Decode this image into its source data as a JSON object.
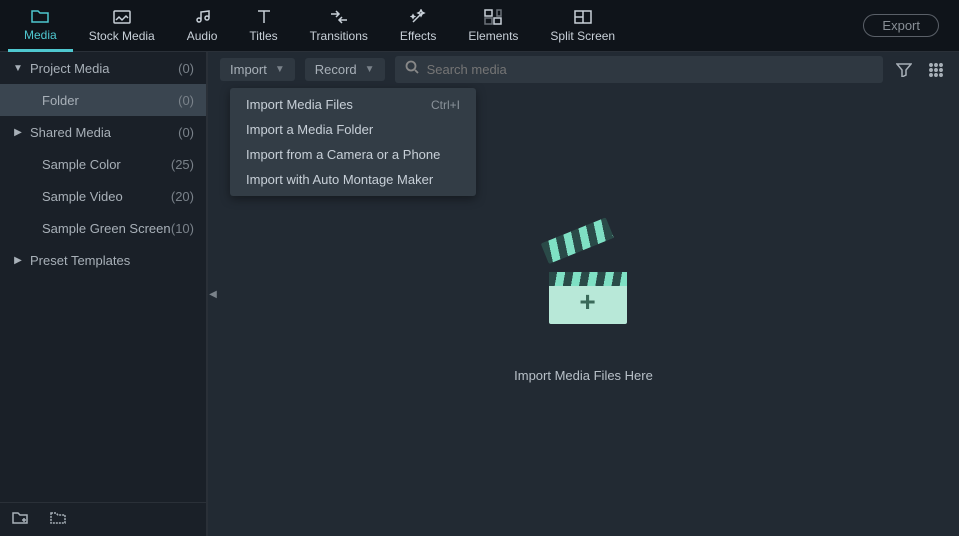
{
  "toolbar": {
    "items": [
      {
        "label": "Media"
      },
      {
        "label": "Stock Media"
      },
      {
        "label": "Audio"
      },
      {
        "label": "Titles"
      },
      {
        "label": "Transitions"
      },
      {
        "label": "Effects"
      },
      {
        "label": "Elements"
      },
      {
        "label": "Split Screen"
      }
    ],
    "export": "Export"
  },
  "sidebar": {
    "items": [
      {
        "label": "Project Media",
        "count": "(0)"
      },
      {
        "label": "Folder",
        "count": "(0)"
      },
      {
        "label": "Shared Media",
        "count": "(0)"
      },
      {
        "label": "Sample Color",
        "count": "(25)"
      },
      {
        "label": "Sample Video",
        "count": "(20)"
      },
      {
        "label": "Sample Green Screen",
        "count": "(10)"
      },
      {
        "label": "Preset Templates",
        "count": ""
      }
    ]
  },
  "content": {
    "import_label": "Import",
    "record_label": "Record",
    "search_placeholder": "Search media",
    "hint": "Import Media Files Here"
  },
  "import_menu": {
    "items": [
      {
        "label": "Import Media Files",
        "shortcut": "Ctrl+I"
      },
      {
        "label": "Import a Media Folder",
        "shortcut": ""
      },
      {
        "label": "Import from a Camera or a Phone",
        "shortcut": ""
      },
      {
        "label": "Import with Auto Montage Maker",
        "shortcut": ""
      }
    ]
  }
}
